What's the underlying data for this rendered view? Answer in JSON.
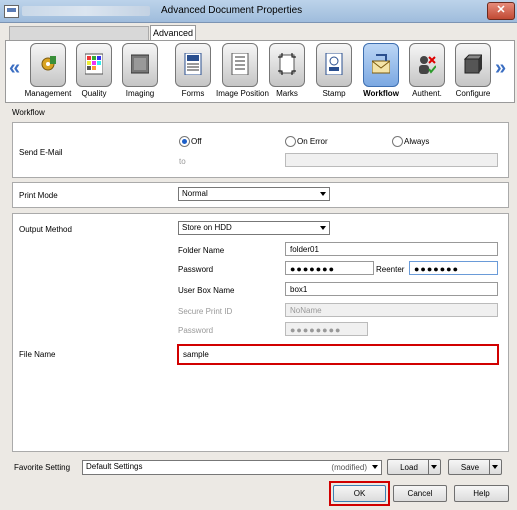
{
  "window": {
    "title": "Advanced Document Properties",
    "close_glyph": "✕"
  },
  "tabs": {
    "active": "Advanced"
  },
  "toolbar": {
    "items": [
      {
        "label": "Management",
        "icon": "gear-paint-icon"
      },
      {
        "label": "Quality",
        "icon": "color-grid-icon"
      },
      {
        "label": "Imaging",
        "icon": "image-icon"
      },
      {
        "label": "Forms",
        "icon": "forms-icon"
      },
      {
        "label": "Image Position",
        "icon": "image-position-icon"
      },
      {
        "label": "Marks",
        "icon": "marks-icon"
      },
      {
        "label": "Stamp",
        "icon": "stamp-icon"
      },
      {
        "label": "Workflow",
        "icon": "workflow-icon"
      },
      {
        "label": "Authent.",
        "icon": "authentication-icon"
      },
      {
        "label": "Configure",
        "icon": "configure-icon"
      }
    ],
    "active_index": 7,
    "left_arrow": "«",
    "right_arrow": "»"
  },
  "section": {
    "title": "Workflow"
  },
  "send_email": {
    "label": "Send E-Mail",
    "options": [
      "Off",
      "On Error",
      "Always"
    ],
    "selected": "Off",
    "to_label": "to",
    "to_value": ""
  },
  "print_mode": {
    "label": "Print Mode",
    "value": "Normal"
  },
  "output_method": {
    "label": "Output Method",
    "value": "Store on HDD",
    "folder_name_label": "Folder Name",
    "folder_name_value": "folder01",
    "password_label": "Password",
    "password_value": "●●●●●●●",
    "reenter_label": "Reenter",
    "reenter_value": "●●●●●●●",
    "user_box_label": "User Box Name",
    "user_box_value": "box1",
    "secure_id_label": "Secure Print ID",
    "secure_id_placeholder": "NoName",
    "secure_pw_label": "Password",
    "secure_pw_value": "●●●●●●●●"
  },
  "file_name": {
    "label": "File Name",
    "value": "sample"
  },
  "favorite": {
    "label": "Favorite Setting",
    "value": "Default Settings",
    "status": "(modified)"
  },
  "buttons": {
    "load": "Load",
    "save": "Save",
    "ok": "OK",
    "cancel": "Cancel",
    "help": "Help"
  },
  "colors": {
    "accent": "#1c5fc9",
    "highlight": "#d10000"
  }
}
